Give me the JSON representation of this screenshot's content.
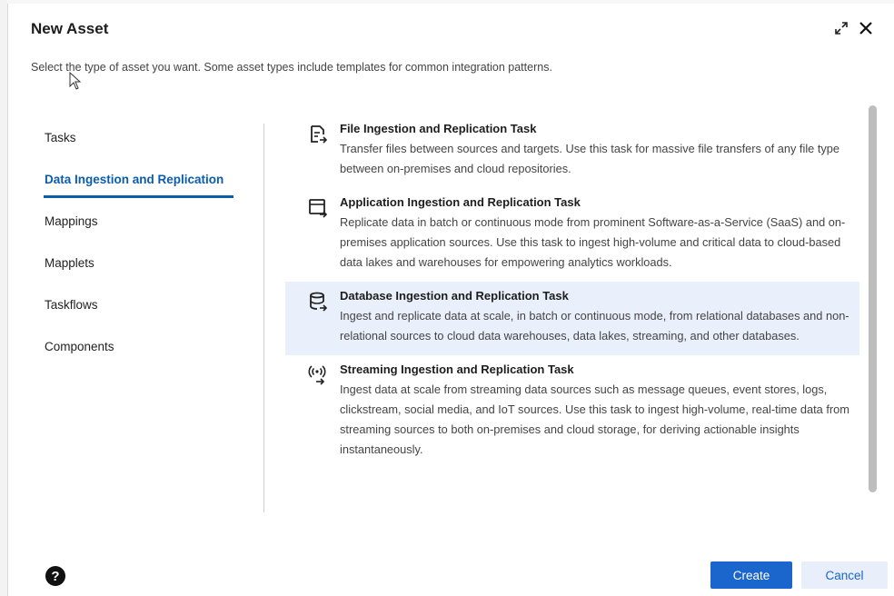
{
  "dialog": {
    "title": "New Asset",
    "subtitle": "Select the type of asset you want. Some asset types include templates for common integration patterns.",
    "expand_icon": "expand-diagonal-arrows",
    "close_icon": "x-close"
  },
  "nav": {
    "items": [
      {
        "label": "Tasks"
      },
      {
        "label": "Data Ingestion and Replication"
      },
      {
        "label": "Mappings"
      },
      {
        "label": "Mapplets"
      },
      {
        "label": "Taskflows"
      },
      {
        "label": "Components"
      }
    ],
    "active_index": 1,
    "active_color": "#0b5cad"
  },
  "assets": [
    {
      "name": "File Ingestion and Replication Task",
      "desc": "Transfer files between sources and targets. Use this task for massive file transfers of any file type between on-premises and cloud repositories.",
      "icon": "file-ingestion-icon"
    },
    {
      "name": "Application Ingestion and Replication Task",
      "desc": "Replicate data in batch or continuous mode from prominent Software-as-a-Service (SaaS) and on-premises application sources. Use this task to ingest high-volume and critical data to cloud-based data lakes and warehouses for empowering analytics workloads.",
      "icon": "application-ingestion-icon"
    },
    {
      "name": "Database Ingestion and Replication Task",
      "desc": "Ingest and replicate data at scale, in batch or continuous mode, from relational databases and non-relational sources to cloud data warehouses, data lakes, streaming, and other databases.",
      "icon": "database-ingestion-icon",
      "selected": true
    },
    {
      "name": "Streaming Ingestion and Replication Task",
      "desc": "Ingest data at scale from streaming data sources such as message queues, event stores, logs, clickstream, social media, and IoT sources. Use this task to ingest high-volume, real-time data from streaming sources to both on-premises and cloud storage, for deriving actionable insights instantaneously.",
      "icon": "streaming-ingestion-icon"
    }
  ],
  "footer": {
    "help_icon": "question-mark-circle",
    "help_glyph": "?",
    "create_label": "Create",
    "cancel_label": "Cancel"
  },
  "colors": {
    "primary": "#1a66cc",
    "selected_row": "#eaf0fb",
    "secondary_button": "#e8eefa"
  }
}
